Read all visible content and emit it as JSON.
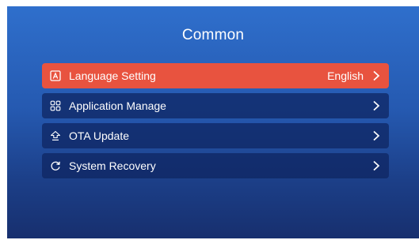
{
  "header": {
    "title": "Common"
  },
  "menu": {
    "items": [
      {
        "label": "Language Setting",
        "value": "English",
        "icon": "language-icon",
        "selected": true
      },
      {
        "label": "Application Manage",
        "value": "",
        "icon": "apps-grid-icon",
        "selected": false
      },
      {
        "label": "OTA Update",
        "value": "",
        "icon": "update-icon",
        "selected": false
      },
      {
        "label": "System Recovery",
        "value": "",
        "icon": "recovery-icon",
        "selected": false
      }
    ]
  },
  "colors": {
    "background_top": "#2f6fcc",
    "background_bottom": "#172f6e",
    "selected_row": "#e8533f",
    "row": "#0e2460"
  }
}
